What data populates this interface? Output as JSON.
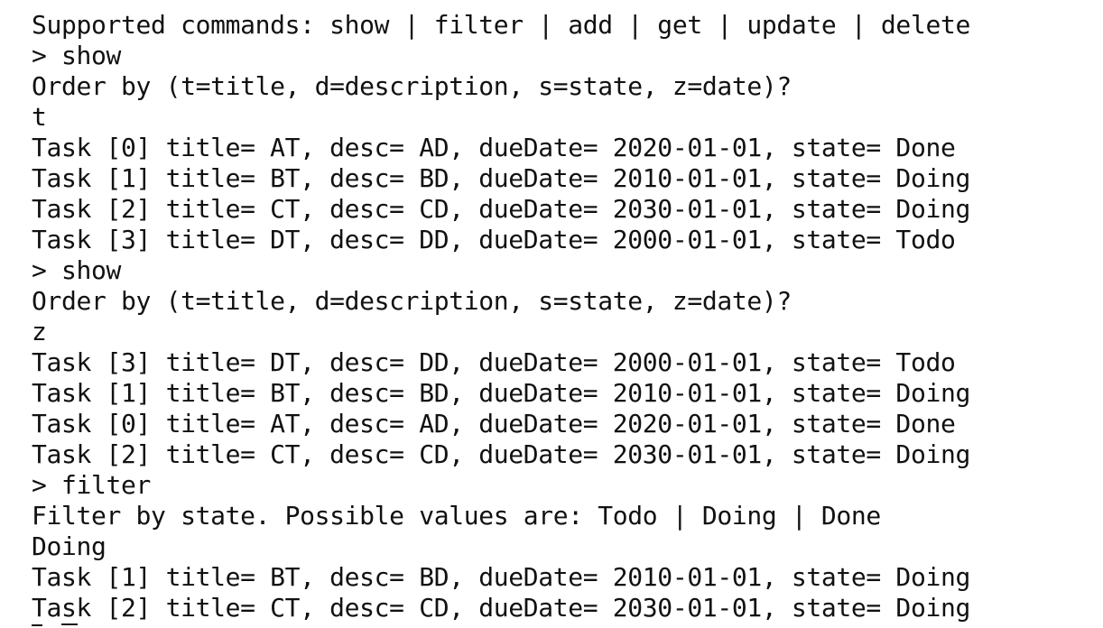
{
  "terminal": {
    "top_clipped": ">",
    "lines": [
      "Supported commands: show | filter | add | get | update | delete",
      "> show",
      "Order by (t=title, d=description, s=state, z=date)?",
      "t",
      "Task [0] title= AT, desc= AD, dueDate= 2020-01-01, state= Done",
      "Task [1] title= BT, desc= BD, dueDate= 2010-01-01, state= Doing",
      "Task [2] title= CT, desc= CD, dueDate= 2030-01-01, state= Doing",
      "Task [3] title= DT, desc= DD, dueDate= 2000-01-01, state= Todo",
      "> show",
      "Order by (t=title, d=description, s=state, z=date)?",
      "z",
      "Task [3] title= DT, desc= DD, dueDate= 2000-01-01, state= Todo",
      "Task [1] title= BT, desc= BD, dueDate= 2010-01-01, state= Doing",
      "Task [0] title= AT, desc= AD, dueDate= 2020-01-01, state= Done",
      "Task [2] title= CT, desc= CD, dueDate= 2030-01-01, state= Doing",
      "> filter",
      "Filter by state. Possible values are: Todo | Doing | Done",
      "Doing",
      "Task [1] title= BT, desc= BD, dueDate= 2010-01-01, state= Doing",
      "Task [2] title= CT, desc= CD, dueDate= 2030-01-01, state= Doing"
    ]
  }
}
